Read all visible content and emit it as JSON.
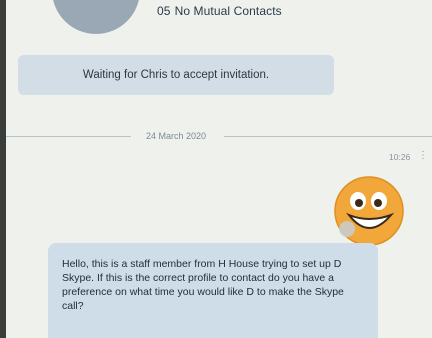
{
  "contact": {
    "mutual_count": "05",
    "mutual_label": "No Mutual Contacts"
  },
  "invitation": {
    "status_text": "Waiting for Chris to accept invitation."
  },
  "conversation": {
    "date_separator": "24 March 2020",
    "messages": [
      {
        "time": "10:26",
        "type": "emoji",
        "emoji": "grinning-face-emoji"
      },
      {
        "type": "text",
        "text": "Hello, this is a staff member from H House trying to set up D Skype. If this is the correct profile to contact do you have a preference on what time you would like D to make the Skype call?"
      }
    ]
  },
  "colors": {
    "banner_bg": "#d2dde6",
    "bubble_bg": "#cfdde8",
    "emoji_face": "#f2a73a"
  }
}
